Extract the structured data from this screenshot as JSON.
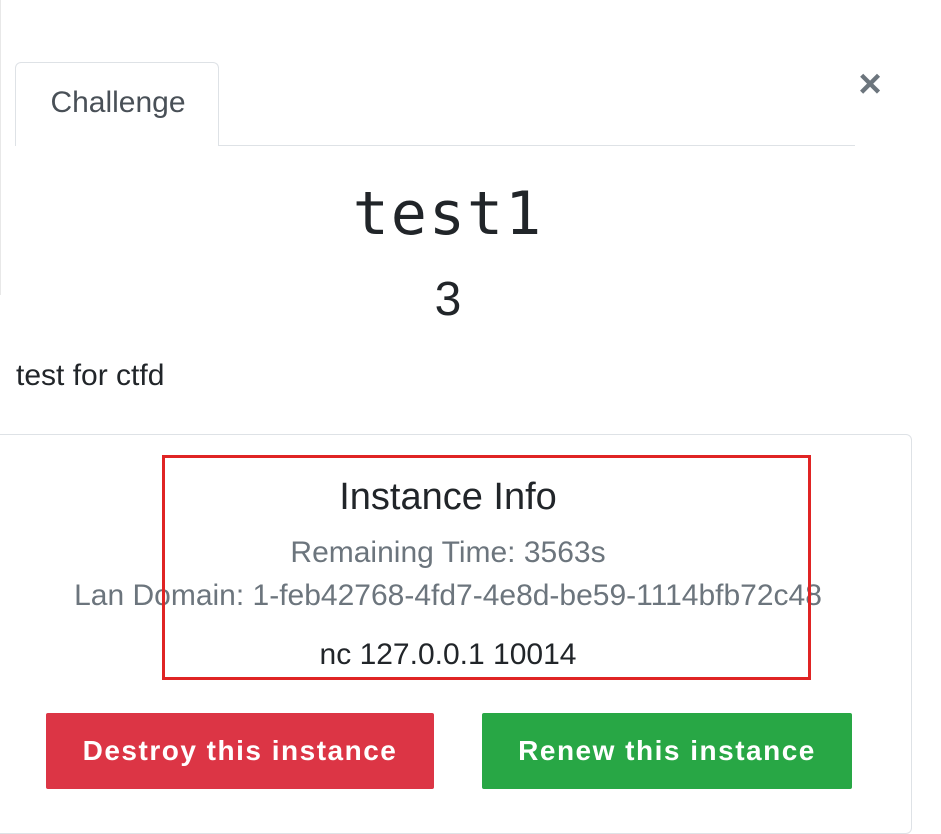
{
  "tabs": [
    {
      "label": "Challenge"
    }
  ],
  "close": {
    "label": "×"
  },
  "challenge": {
    "name": "test1",
    "value": "3",
    "description": "test for ctfd"
  },
  "instance": {
    "heading": "Instance Info",
    "remaining_time": "Remaining Time: 3563s",
    "lan_domain": "Lan Domain: 1-feb42768-4fd7-4e8d-be59-1114bfb72c48",
    "connection": "nc 127.0.0.1 10014"
  },
  "buttons": {
    "destroy_label": "Destroy this instance",
    "renew_label": "Renew this instance"
  },
  "colors": {
    "destroy": "#dc3545",
    "renew": "#28a745",
    "highlight": "#e02424",
    "muted_text": "#6c757d"
  }
}
